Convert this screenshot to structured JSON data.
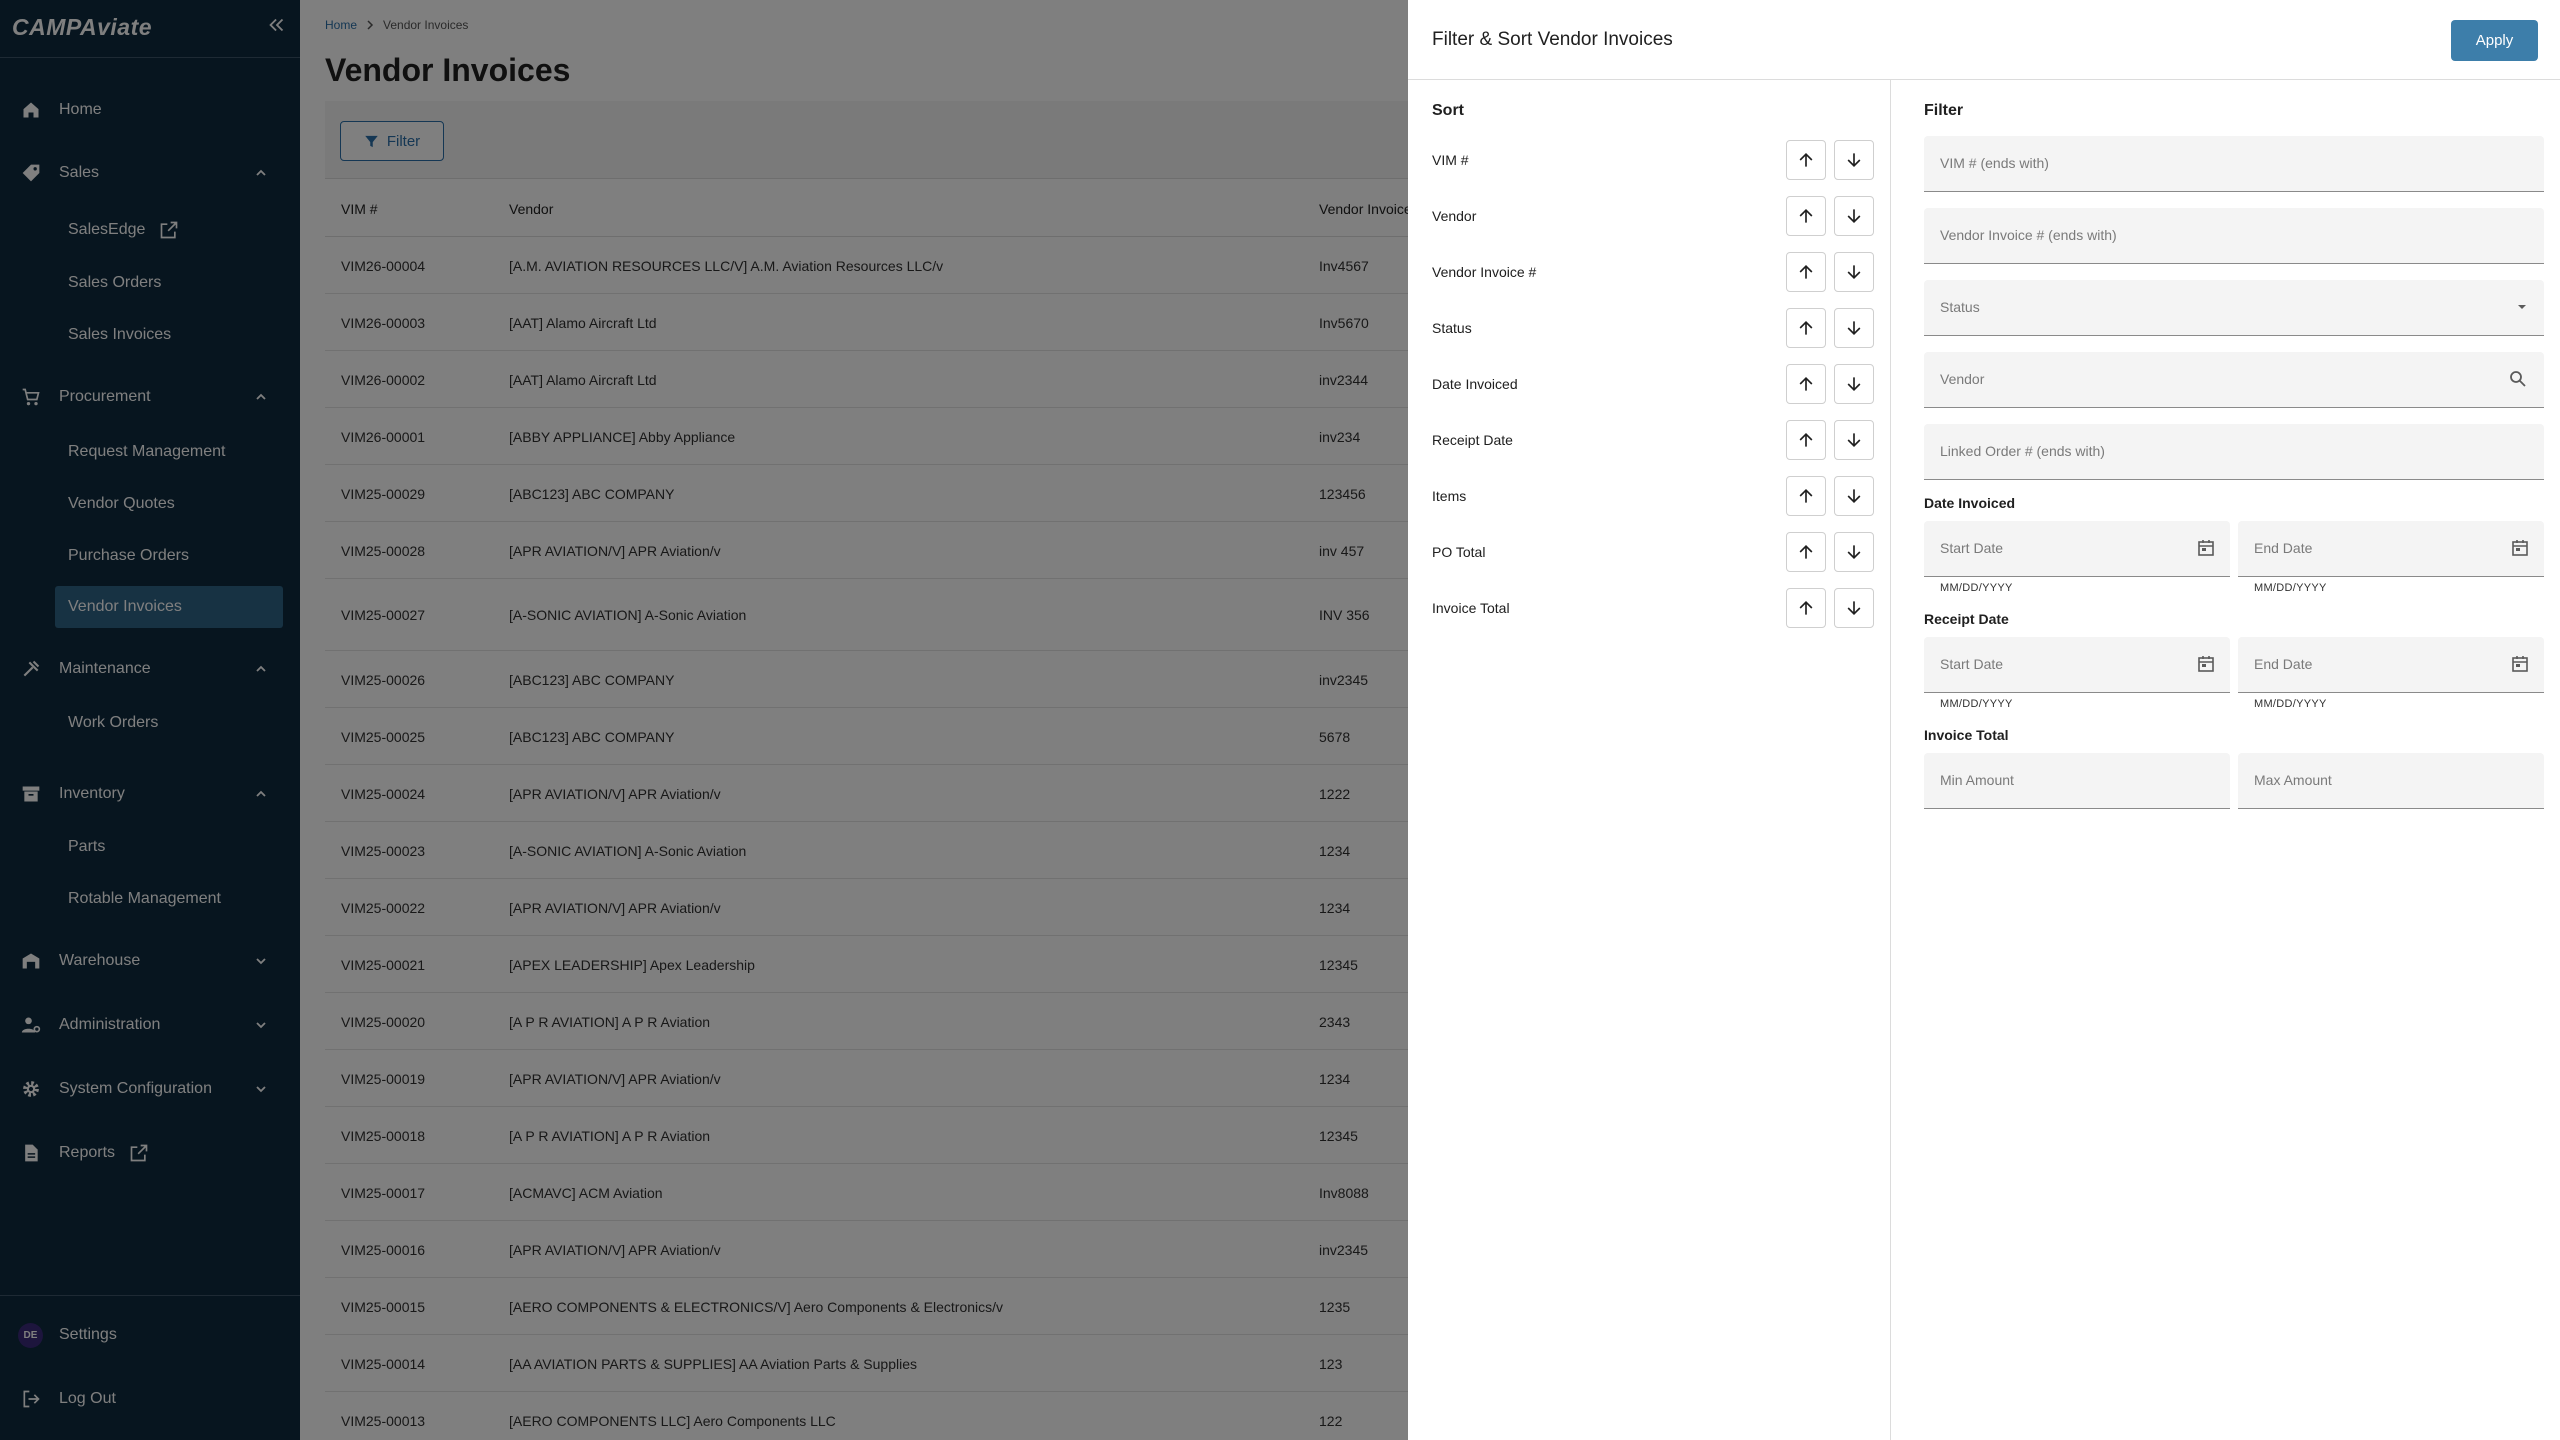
{
  "app": {
    "logo": "CAMPAviate"
  },
  "sidebar": {
    "home": "Home",
    "sales": {
      "label": "Sales",
      "items": [
        "SalesEdge",
        "Sales Orders",
        "Sales Invoices"
      ]
    },
    "procurement": {
      "label": "Procurement",
      "items": [
        "Request Management",
        "Vendor Quotes",
        "Purchase Orders",
        "Vendor Invoices"
      ]
    },
    "maintenance": {
      "label": "Maintenance",
      "items": [
        "Work Orders"
      ]
    },
    "inventory": {
      "label": "Inventory",
      "items": [
        "Parts",
        "Rotable Management"
      ]
    },
    "warehouse": "Warehouse",
    "administration": "Administration",
    "system_configuration": "System Configuration",
    "reports": "Reports",
    "settings": "Settings",
    "avatar_initials": "DE",
    "logout": "Log Out"
  },
  "main": {
    "breadcrumb": {
      "home": "Home",
      "current": "Vendor Invoices"
    },
    "title": "Vendor Invoices",
    "filter_button": "Filter",
    "columns": [
      "VIM #",
      "Vendor",
      "Vendor Invoice #"
    ],
    "rows": [
      [
        "VIM26-00004",
        "[A.M. AVIATION RESOURCES LLC/V] A.M. Aviation Resources LLC/v",
        "Inv4567"
      ],
      [
        "VIM26-00003",
        "[AAT] Alamo Aircraft Ltd",
        "Inv5670"
      ],
      [
        "VIM26-00002",
        "[AAT] Alamo Aircraft Ltd",
        "inv2344"
      ],
      [
        "VIM26-00001",
        "[ABBY APPLIANCE] Abby Appliance",
        "inv234"
      ],
      [
        "VIM25-00029",
        "[ABC123] ABC COMPANY",
        "123456"
      ],
      [
        "VIM25-00028",
        "[APR AVIATION/V] APR Aviation/v",
        "inv 457"
      ],
      [
        "VIM25-00027",
        "[A-SONIC AVIATION] A-Sonic Aviation",
        "INV 356"
      ],
      [
        "VIM25-00026",
        "[ABC123] ABC COMPANY",
        "inv2345"
      ],
      [
        "VIM25-00025",
        "[ABC123] ABC COMPANY",
        "5678"
      ],
      [
        "VIM25-00024",
        "[APR AVIATION/V] APR Aviation/v",
        "1222"
      ],
      [
        "VIM25-00023",
        "[A-SONIC AVIATION] A-Sonic Aviation",
        "1234"
      ],
      [
        "VIM25-00022",
        "[APR AVIATION/V] APR Aviation/v",
        "1234"
      ],
      [
        "VIM25-00021",
        "[APEX LEADERSHIP] Apex Leadership",
        "12345"
      ],
      [
        "VIM25-00020",
        "[A P R AVIATION] A P R Aviation",
        "2343"
      ],
      [
        "VIM25-00019",
        "[APR AVIATION/V] APR Aviation/v",
        "1234"
      ],
      [
        "VIM25-00018",
        "[A P R AVIATION] A P R Aviation",
        "12345"
      ],
      [
        "VIM25-00017",
        "[ACMAVC] ACM Aviation",
        "Inv8088"
      ],
      [
        "VIM25-00016",
        "[APR AVIATION/V] APR Aviation/v",
        "inv2345"
      ],
      [
        "VIM25-00015",
        "[AERO COMPONENTS & ELECTRONICS/V] Aero Components & Electronics/v",
        "1235"
      ],
      [
        "VIM25-00014",
        "[AA AVIATION PARTS & SUPPLIES] AA Aviation Parts & Supplies",
        "123"
      ],
      [
        "VIM25-00013",
        "[AERO COMPONENTS LLC] Aero Components LLC",
        "122"
      ]
    ]
  },
  "drawer": {
    "title": "Filter & Sort Vendor Invoices",
    "apply": "Apply",
    "sort_heading": "Sort",
    "sort_fields": [
      "VIM #",
      "Vendor",
      "Vendor Invoice #",
      "Status",
      "Date Invoiced",
      "Receipt Date",
      "Items",
      "PO Total",
      "Invoice Total"
    ],
    "filter_heading": "Filter",
    "fields": {
      "vim": "VIM # (ends with)",
      "vendor_invoice": "Vendor Invoice # (ends with)",
      "status": "Status",
      "vendor": "Vendor",
      "linked_order": "Linked Order # (ends with)"
    },
    "date_invoiced": {
      "label": "Date Invoiced",
      "start": "Start Date",
      "end": "End Date",
      "format": "MM/DD/YYYY"
    },
    "receipt_date": {
      "label": "Receipt Date",
      "start": "Start Date",
      "end": "End Date",
      "format": "MM/DD/YYYY"
    },
    "invoice_total": {
      "label": "Invoice Total",
      "min": "Min Amount",
      "max": "Max Amount"
    }
  },
  "colors": {
    "sidebar": "#0e2a3e",
    "active": "#2f6486",
    "accent": "#3d7eaa"
  }
}
